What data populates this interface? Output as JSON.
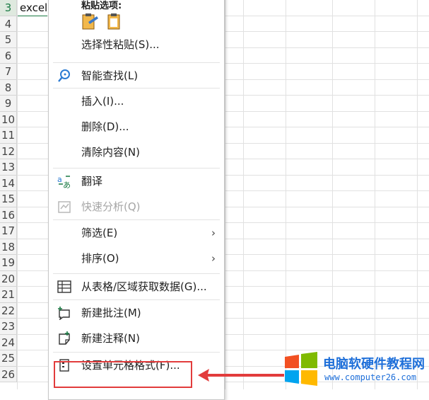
{
  "sheet": {
    "cell_a3": "excel",
    "rows": [
      "3",
      "4",
      "5",
      "6",
      "7",
      "8",
      "9",
      "10",
      "11",
      "12",
      "13",
      "14",
      "15",
      "16",
      "17",
      "18",
      "19",
      "20",
      "21",
      "22",
      "23",
      "24",
      "25",
      "26"
    ]
  },
  "menu": {
    "paste_header": "粘贴选项:",
    "paste_icons": [
      "paste-format-icon",
      "paste-icon"
    ],
    "items": [
      {
        "label": "选择性粘贴(S)...",
        "icon": "",
        "disabled": false,
        "submenu": false
      },
      {
        "label": "智能查找(L)",
        "icon": "smart-lookup-icon",
        "disabled": false,
        "submenu": false
      },
      {
        "label": "插入(I)...",
        "icon": "",
        "disabled": false,
        "submenu": false
      },
      {
        "label": "删除(D)...",
        "icon": "",
        "disabled": false,
        "submenu": false
      },
      {
        "label": "清除内容(N)",
        "icon": "",
        "disabled": false,
        "submenu": false
      },
      {
        "label": "翻译",
        "icon": "translate-icon",
        "disabled": false,
        "submenu": false
      },
      {
        "label": "快速分析(Q)",
        "icon": "quick-analysis-icon",
        "disabled": true,
        "submenu": false
      },
      {
        "label": "筛选(E)",
        "icon": "",
        "disabled": false,
        "submenu": true
      },
      {
        "label": "排序(O)",
        "icon": "",
        "disabled": false,
        "submenu": true
      },
      {
        "label": "从表格/区域获取数据(G)...",
        "icon": "table-range-icon",
        "disabled": false,
        "submenu": false
      },
      {
        "label": "新建批注(M)",
        "icon": "new-comment-icon",
        "disabled": false,
        "submenu": false
      },
      {
        "label": "新建注释(N)",
        "icon": "new-note-icon",
        "disabled": false,
        "submenu": false
      },
      {
        "label": "设置单元格格式(F)...",
        "icon": "format-cells-icon",
        "disabled": false,
        "submenu": false
      }
    ],
    "submenu_arrow": "›"
  },
  "watermark": {
    "title": "电脑软硬件教程网",
    "url": "www.computer26.com"
  },
  "colors": {
    "highlight": "#e23c3c",
    "accent_green": "#1a7a43",
    "watermark_blue": "#1e6fd9"
  }
}
